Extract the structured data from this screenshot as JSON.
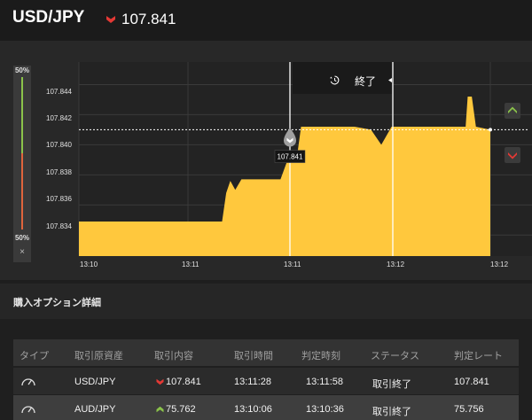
{
  "header": {
    "pair": "USD/JPY",
    "direction": "down",
    "rate": "107.841"
  },
  "colors": {
    "up": "#8bc34a",
    "down": "#e53935",
    "area_fill": "#ffc83d",
    "panel": "#282828",
    "background": "#1e1e1e"
  },
  "meter": {
    "top_label": "50%",
    "bottom_label": "50%",
    "close_label": "×"
  },
  "callout": {
    "icon": "history-icon",
    "label": "終了"
  },
  "price_tag": "107.841",
  "side_buttons": {
    "up": "chevron-up-icon",
    "down": "chevron-down-icon"
  },
  "chart_data": {
    "type": "area",
    "y_ticks": [
      "107.844",
      "107.842",
      "107.840",
      "107.838",
      "107.836",
      "107.834"
    ],
    "x_ticks": [
      "13:10",
      "13:11",
      "13:11",
      "13:12",
      "13:12"
    ],
    "ylim": [
      107.8326,
      107.8455
    ],
    "current_rate": 107.841,
    "entry_marker_y": 107.8404,
    "points": [
      [
        0,
        107.8349
      ],
      [
        0.348,
        107.8349
      ],
      [
        0.358,
        107.8368
      ],
      [
        0.368,
        107.8376
      ],
      [
        0.38,
        107.837
      ],
      [
        0.395,
        107.8377
      ],
      [
        0.49,
        107.8377
      ],
      [
        0.51,
        107.8392
      ],
      [
        0.53,
        107.8392
      ],
      [
        0.54,
        107.8412
      ],
      [
        0.67,
        107.8412
      ],
      [
        0.71,
        107.841
      ],
      [
        0.735,
        107.84
      ],
      [
        0.76,
        107.8412
      ],
      [
        0.94,
        107.8412
      ],
      [
        0.945,
        107.8432
      ],
      [
        0.955,
        107.8432
      ],
      [
        0.965,
        107.8412
      ],
      [
        1.0,
        107.841
      ]
    ]
  },
  "section": {
    "title": "購入オプション詳細"
  },
  "table": {
    "headers": [
      "タイプ",
      "取引原資産",
      "取引内容",
      "取引時間",
      "判定時刻",
      "ステータス",
      "判定レート"
    ],
    "rows": [
      {
        "type_icon": "gauge-icon",
        "asset": "USD/JPY",
        "direction": "down",
        "rate": "107.841",
        "time": "13:11:28",
        "judge_time": "13:11:58",
        "status": "取引終了",
        "judge_rate": "107.841"
      },
      {
        "type_icon": "gauge-icon",
        "asset": "AUD/JPY",
        "direction": "up",
        "rate": "75.762",
        "time": "13:10:06",
        "judge_time": "13:10:36",
        "status": "取引終了",
        "judge_rate": "75.756"
      }
    ]
  }
}
